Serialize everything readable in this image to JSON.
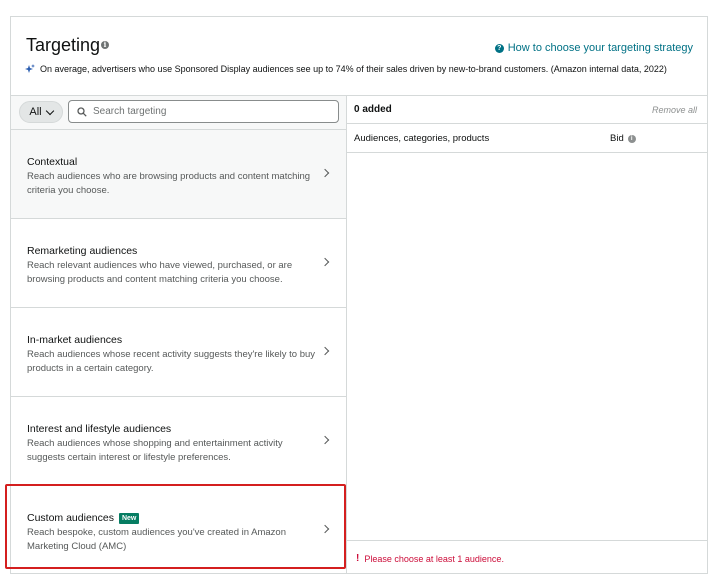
{
  "header": {
    "title": "Targeting",
    "help_link": "How to choose your targeting strategy",
    "stat": "On average, advertisers who use Sponsored Display audiences see up to 74% of their sales driven by new-to-brand customers. (Amazon internal data, 2022)"
  },
  "search": {
    "filter_label": "All",
    "placeholder": "Search targeting"
  },
  "categories": [
    {
      "title": "Contextual",
      "description": "Reach audiences who are browsing products and content matching criteria you choose."
    },
    {
      "title": "Remarketing audiences",
      "description": "Reach relevant audiences who have viewed, purchased, or are browsing products and content matching criteria you choose."
    },
    {
      "title": "In-market audiences",
      "description": "Reach audiences whose recent activity suggests they're likely to buy products in a certain category."
    },
    {
      "title": "Interest and lifestyle audiences",
      "description": "Reach audiences whose shopping and entertainment activity suggests certain interest or lifestyle preferences."
    },
    {
      "title": "Custom audiences",
      "badge": "New",
      "description": "Reach bespoke, custom audiences you've created in Amazon Marketing Cloud (AMC)"
    }
  ],
  "added": {
    "count_label": "0 added",
    "remove_all": "Remove all",
    "col_audiences": "Audiences, categories, products",
    "col_bid": "Bid",
    "error": "Please choose at least 1 audience."
  },
  "colors": {
    "link": "#007185",
    "error": "#cc0c39",
    "badge": "#067d62",
    "highlight": "#d41f1f"
  }
}
